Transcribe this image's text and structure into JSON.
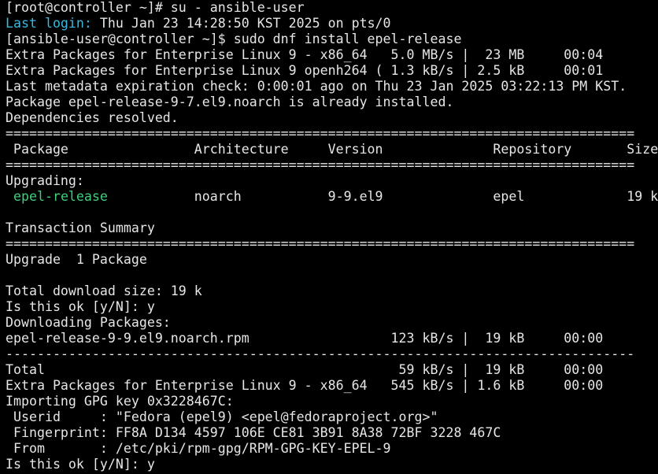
{
  "terminal": {
    "lines": [
      [
        {
          "text": "[root@controller ~]# su - ansible-user"
        }
      ],
      [
        {
          "text": "Last login:",
          "color": "cyan"
        },
        {
          "text": " Thu Jan 23 14:28:50 KST 2025 on pts/0"
        }
      ],
      [
        {
          "text": "[ansible-user@controller ~]$ sudo dnf install epel-release"
        }
      ],
      [
        {
          "text": "Extra Packages for Enterprise Linux 9 - x86_64   5.0 MB/s |  23 MB     00:04"
        }
      ],
      [
        {
          "text": "Extra Packages for Enterprise Linux 9 openh264 ( 1.3 kB/s | 2.5 kB     00:01"
        }
      ],
      [
        {
          "text": "Last metadata expiration check: 0:00:01 ago on Thu 23 Jan 2025 03:22:13 PM KST."
        }
      ],
      [
        {
          "text": "Package epel-release-9-7.el9.noarch is already installed."
        }
      ],
      [
        {
          "text": "Dependencies resolved."
        }
      ],
      [
        {
          "text": "================================================================================"
        }
      ],
      [
        {
          "text": " Package                Architecture     Version              Repository       Size"
        }
      ],
      [
        {
          "text": "================================================================================"
        }
      ],
      [
        {
          "text": "Upgrading:"
        }
      ],
      [
        {
          "text": " "
        },
        {
          "text": "epel-release",
          "color": "green"
        },
        {
          "text": "           noarch           9-9.el9              epel             19 k"
        }
      ],
      [
        {
          "text": ""
        }
      ],
      [
        {
          "text": "Transaction Summary"
        }
      ],
      [
        {
          "text": "================================================================================"
        }
      ],
      [
        {
          "text": "Upgrade  1 Package"
        }
      ],
      [
        {
          "text": ""
        }
      ],
      [
        {
          "text": "Total download size: 19 k"
        }
      ],
      [
        {
          "text": "Is this ok [y/N]: y"
        }
      ],
      [
        {
          "text": "Downloading Packages:"
        }
      ],
      [
        {
          "text": "epel-release-9-9.el9.noarch.rpm                  123 kB/s |  19 kB     00:00"
        }
      ],
      [
        {
          "text": "--------------------------------------------------------------------------------"
        }
      ],
      [
        {
          "text": "Total                                             59 kB/s |  19 kB     00:00"
        }
      ],
      [
        {
          "text": "Extra Packages for Enterprise Linux 9 - x86_64   545 kB/s | 1.6 kB     00:00"
        }
      ],
      [
        {
          "text": "Importing GPG key 0x3228467C:"
        }
      ],
      [
        {
          "text": " Userid     : \"Fedora (epel9) <epel@fedoraproject.org>\""
        }
      ],
      [
        {
          "text": " Fingerprint: FF8A D134 4597 106E CE81 3B91 8A38 72BF 3228 467C"
        }
      ],
      [
        {
          "text": " From       : /etc/pki/rpm-gpg/RPM-GPG-KEY-EPEL-9"
        }
      ],
      [
        {
          "text": "Is this ok [y/N]: y"
        }
      ]
    ],
    "colors": {
      "background": "#000000",
      "foreground": "#e6e6e6",
      "cyan": "#3bb8e0",
      "green": "#3fd07a"
    }
  }
}
